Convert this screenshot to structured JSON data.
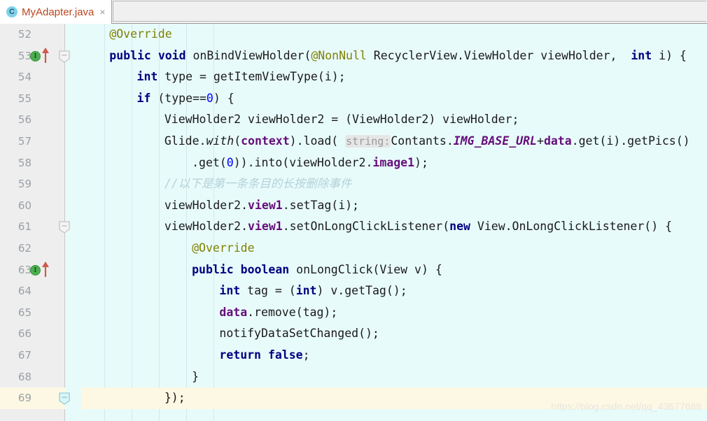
{
  "tab": {
    "icon": "class-file-icon",
    "icon_letter": "C",
    "title": "MyAdapter.java",
    "close_label": "×"
  },
  "editor": {
    "watermark": "https://blog.csdn.net/qq_43677688",
    "caret_line": 69,
    "first_line": 52,
    "last_line": 69,
    "colors": {
      "background": "#e8fbfb",
      "gutter": "#eeeeee",
      "caret_line": "#fdf8e3",
      "keyword": "#000080",
      "annotation": "#808000",
      "number": "#0000ff",
      "field": "#660e7a",
      "comment": "#b4d2d8",
      "tab_title": "#b8471f"
    },
    "lines": [
      {
        "n": "52",
        "indent": 4,
        "marker": null,
        "fold": null,
        "text": "@Override"
      },
      {
        "n": "53",
        "indent": 4,
        "marker": "implements-method-icon",
        "fold": "fold-collapse-marker",
        "text": "public void onBindViewHolder(@NonNull RecyclerView.ViewHolder viewHolder,  int i) {"
      },
      {
        "n": "54",
        "indent": 8,
        "marker": null,
        "fold": null,
        "text": "int type = getItemViewType(i);"
      },
      {
        "n": "55",
        "indent": 8,
        "marker": null,
        "fold": null,
        "text": "if (type==0) {"
      },
      {
        "n": "56",
        "indent": 12,
        "marker": null,
        "fold": null,
        "text": "ViewHolder2 viewHolder2 = (ViewHolder2) viewHolder;"
      },
      {
        "n": "57",
        "indent": 12,
        "marker": null,
        "fold": null,
        "text": "Glide.with(context).load( string: Contants.IMG_BASE_URL+data.get(i).getPics()"
      },
      {
        "n": "58",
        "indent": 16,
        "marker": null,
        "fold": null,
        "text": ".get(0)).into(viewHolder2.image1);"
      },
      {
        "n": "59",
        "indent": 12,
        "marker": null,
        "fold": null,
        "text": "//以下是第一条条目的长按删除事件"
      },
      {
        "n": "60",
        "indent": 12,
        "marker": null,
        "fold": null,
        "text": "viewHolder2.view1.setTag(i);"
      },
      {
        "n": "61",
        "indent": 12,
        "marker": null,
        "fold": "fold-collapse-marker",
        "text": "viewHolder2.view1.setOnLongClickListener(new View.OnLongClickListener() {"
      },
      {
        "n": "62",
        "indent": 16,
        "marker": null,
        "fold": null,
        "text": "@Override"
      },
      {
        "n": "63",
        "indent": 16,
        "marker": "implements-method-icon",
        "fold": null,
        "text": "public boolean onLongClick(View v) {"
      },
      {
        "n": "64",
        "indent": 20,
        "marker": null,
        "fold": null,
        "text": "int tag = (int) v.getTag();"
      },
      {
        "n": "65",
        "indent": 20,
        "marker": null,
        "fold": null,
        "text": "data.remove(tag);"
      },
      {
        "n": "66",
        "indent": 20,
        "marker": null,
        "fold": null,
        "text": "notifyDataSetChanged();"
      },
      {
        "n": "67",
        "indent": 20,
        "marker": null,
        "fold": null,
        "text": "return false;"
      },
      {
        "n": "68",
        "indent": 16,
        "marker": null,
        "fold": null,
        "text": "}"
      },
      {
        "n": "69",
        "indent": 12,
        "marker": null,
        "fold": "fold-expand-marker-active",
        "text": "});"
      }
    ]
  }
}
